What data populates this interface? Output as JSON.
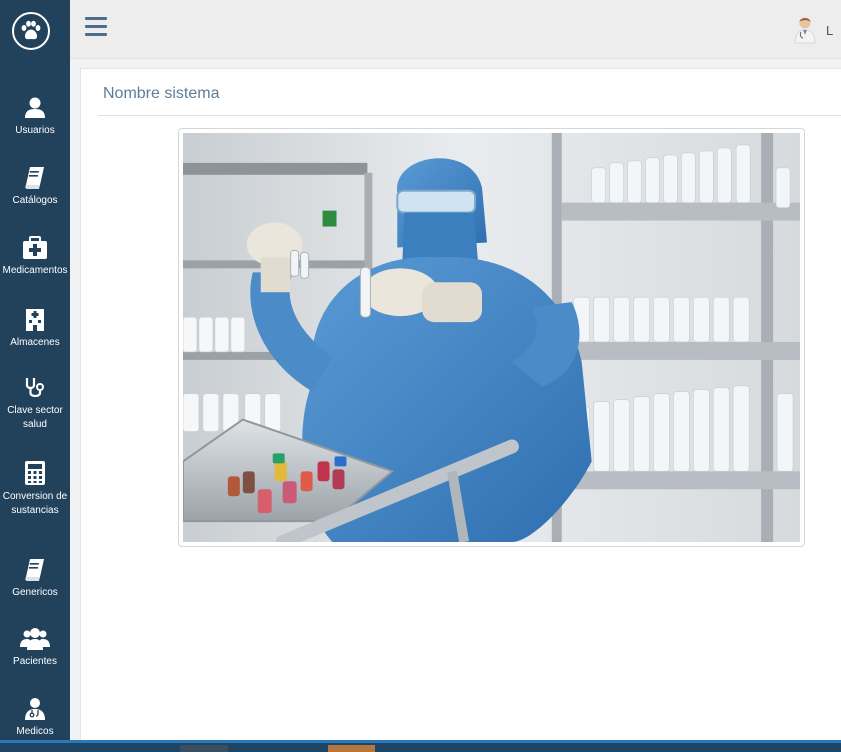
{
  "sidebar": {
    "logo_icon": "paw-icon",
    "items": [
      {
        "label": "Usuarios",
        "icon": "user-icon"
      },
      {
        "label": "Catálogos",
        "icon": "book-icon"
      },
      {
        "label": "Medicamentos",
        "icon": "medkit-icon"
      },
      {
        "label": "Almacenes",
        "icon": "building-icon"
      },
      {
        "label": "Clave sector salud",
        "icon": "stethoscope-icon"
      },
      {
        "label": "Conversion de sustancias",
        "icon": "calculator-icon"
      },
      {
        "label": "Genericos",
        "icon": "book-icon"
      },
      {
        "label": "Pacientes",
        "icon": "users-icon"
      },
      {
        "label": "Medicos",
        "icon": "doctor-icon"
      }
    ]
  },
  "topbar": {
    "menu_icon": "hamburger-icon",
    "user_name": "L",
    "avatar_icon": "doctor-avatar-icon"
  },
  "main": {
    "title": "Nombre sistema",
    "image_alt": "Laboratory worker in blue protective suit holding test tubes beside shelves of bottles"
  },
  "colors": {
    "sidebar_bg": "#22425c",
    "topbar_bg": "#ededed",
    "title_color": "#5f7c96",
    "suit_blue": "#4a8cc9"
  }
}
